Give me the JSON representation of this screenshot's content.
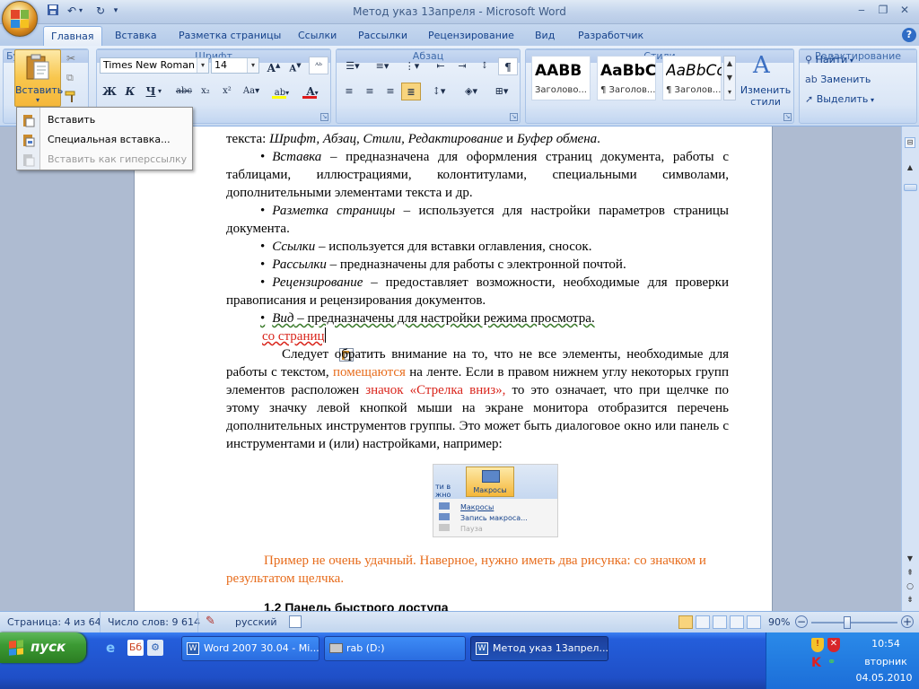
{
  "window": {
    "title": "Метод указ 13апреля - Microsoft Word"
  },
  "qat": {
    "icons": [
      "save-icon",
      "undo-icon",
      "redo-icon",
      "customize-qat-icon"
    ]
  },
  "tabs": [
    {
      "label": "Главная",
      "active": true
    },
    {
      "label": "Вставка"
    },
    {
      "label": "Разметка страницы"
    },
    {
      "label": "Ссылки"
    },
    {
      "label": "Рассылки"
    },
    {
      "label": "Рецензирование"
    },
    {
      "label": "Вид"
    },
    {
      "label": "Разработчик"
    }
  ],
  "ribbon": {
    "clipboard": {
      "paste_label": "Вставить",
      "group_label": "Бу"
    },
    "font": {
      "font_name": "Times New Roman",
      "font_size": "14",
      "group_label": "Шрифт"
    },
    "paragraph": {
      "group_label": "Абзац"
    },
    "styles": {
      "group_label": "Стили",
      "items": [
        {
          "sample": "AABB",
          "name": "Заголово..."
        },
        {
          "sample": "AaBbC",
          "name": "¶ Заголов..."
        },
        {
          "sample": "AaBbCc",
          "name": "¶ Заголов..."
        }
      ],
      "change_label": "Изменить",
      "change_label2": "стили"
    },
    "editing": {
      "group_label": "Редактирование",
      "find": "Найти",
      "replace": "Заменить",
      "select": "Выделить"
    }
  },
  "paste_menu": {
    "items": [
      {
        "label": "Вставить",
        "enabled": true
      },
      {
        "label": "Специальная вставка...",
        "enabled": true
      },
      {
        "label": "Вставить как гиперссылку",
        "enabled": false
      }
    ]
  },
  "document": {
    "line0_prefix": "текста: ",
    "line0_italic": "Шрифт, Абзац, Стили, Редактирование",
    "line0_mid": " и ",
    "line0_italic2": "Буфер обмена",
    "line0_end": ".",
    "bullets": [
      {
        "term": "Вставка",
        "text": " – предназначена для оформления страниц документа, работы с таблицами, иллюстрациями, колонтитулами, специальными символами, дополнительными элементами текста и др."
      },
      {
        "term": "Разметка страницы",
        "text": " – используется для настройки параметров страницы документа."
      },
      {
        "term": "Ссылки",
        "text": " – используется для вставки оглавления, сносок."
      },
      {
        "term": "Рассылки",
        "text": " – предназначены для работы с электронной почтой."
      },
      {
        "term": "Рецензирование",
        "text": " – предоставляет возможности, необходимые для проверки правописания и рецензирования документов."
      },
      {
        "term": "Вид",
        "text": " – предназначены для настройки режима просмотра."
      }
    ],
    "red_fragment": "со страниц",
    "p1_a": "Следует обратить внимание на то, что не все элементы, необходимые для работы с текстом, ",
    "p1_orange": "помещаются",
    "p1_b": " на ленте. Если в правом нижнем углу некоторых групп элементов расположен ",
    "p1_red": "значок «Стрелка вниз»,",
    "p1_c": " то это означает, что при щелчке по этому значку левой кнопкой мыши на экране монитора отобразится перечень дополнительных инструментов группы. Это может быть диалоговое окно или панель с инструментами и (или) настройками, например:",
    "figure": {
      "header": "Макросы",
      "left_cut": "ти в",
      "left_cut2": "жно",
      "items": [
        "Макросы",
        "Запись макроса...",
        "Пауза"
      ]
    },
    "comment": "Пример не очень удачный. Наверное, нужно иметь два рисунка: со значком и результатом щелчка.",
    "heading": "1.2 Панель быстрого доступа"
  },
  "status": {
    "page": "Страница: 4 из 64",
    "words": "Число слов: 9 614",
    "language": "русский",
    "zoom": "90%"
  },
  "taskbar": {
    "start": "пуск",
    "tasks": [
      {
        "label": "Word 2007 30.04 - Mi..."
      },
      {
        "label": "rab (D:)"
      },
      {
        "label": "Метод указ 13апрел...",
        "active": true
      }
    ],
    "lang": "RL",
    "time": "10:54",
    "day": "вторник",
    "date": "04.05.2010"
  }
}
